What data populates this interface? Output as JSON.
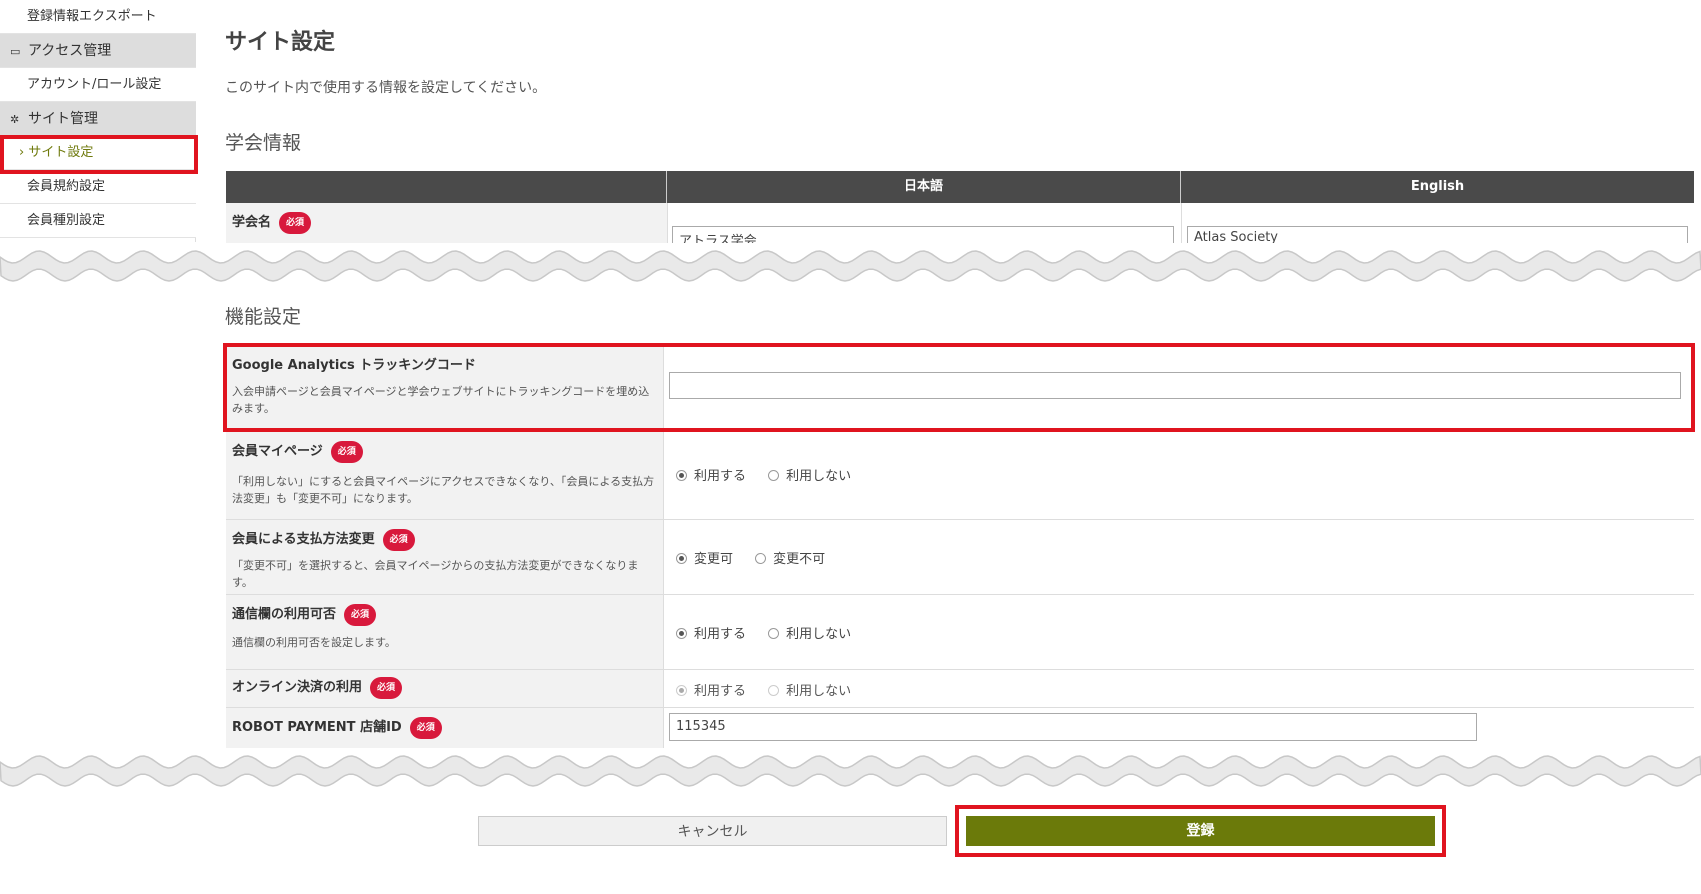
{
  "sidebar": {
    "export": "登録情報エクスポート",
    "access_head": "アクセス管理",
    "account_role": "アカウント/ロール設定",
    "site_head": "サイト管理",
    "site_settings": "› サイト設定",
    "member_terms": "会員規約設定",
    "member_types": "会員種別設定"
  },
  "main": {
    "title": "サイト設定",
    "description": "このサイト内で使用する情報を設定してください。",
    "section_society": "学会情報",
    "col_japanese": "日本語",
    "col_english": "English",
    "society_name_label": "学会名",
    "society_name_ja": "アトラス学会",
    "society_name_en": "Atlas Society",
    "required": "必須",
    "section_features": "機能設定",
    "ga_label": "Google Analytics トラッキングコード",
    "ga_desc": "入会申請ページと会員マイページと学会ウェブサイトにトラッキングコードを埋め込みます。",
    "ga_value": "",
    "mypage_label": "会員マイページ",
    "mypage_desc": "「利用しない」にすると会員マイページにアクセスできなくなり、「会員による支払方法変更」も「変更不可」になります。",
    "use": "利用する",
    "not_use": "利用しない",
    "payment_label": "会員による支払方法変更",
    "payment_desc": "「変更不可」を選択すると、会員マイページからの支払方法変更ができなくなります。",
    "changeable": "変更可",
    "not_changeable": "変更不可",
    "comm_label": "通信欄の利用可否",
    "comm_desc": "通信欄の利用可否を設定します。",
    "online_label": "オンライン決済の利用",
    "robot_label": "ROBOT PAYMENT 店舗ID",
    "robot_value": "115345"
  },
  "buttons": {
    "cancel": "キャンセル",
    "submit": "登録"
  },
  "colors": {
    "accent": "#6b7a0a",
    "required": "#d8193c",
    "highlight": "#e0141f",
    "header": "#4a4a4a"
  }
}
